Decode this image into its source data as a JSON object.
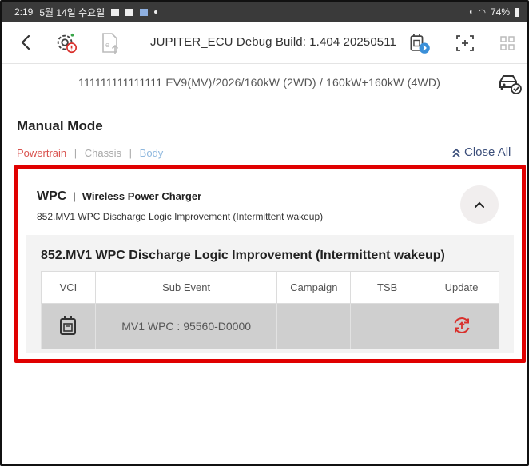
{
  "status_bar": {
    "time": "2:19",
    "date": "5월 14일 수요일",
    "battery": "74%"
  },
  "app_bar": {
    "title": "JUPITER_ECU Debug Build: 1.404 20250511",
    "icons": [
      "back-icon",
      "diagnostic-gear-icon",
      "export-file-icon",
      "vci-bluetooth-icon",
      "add-screen-icon",
      "grid-menu-icon"
    ]
  },
  "vehicle": {
    "info": "111111111111111 EV9(MV)/2026/160kW (2WD) / 160kW+160kW (4WD)",
    "icon": "vehicle-check-icon"
  },
  "manual_mode": {
    "title": "Manual Mode",
    "tabs": {
      "powertrain": "Powertrain",
      "chassis": "Chassis",
      "body": "Body",
      "separator": "|"
    },
    "close_all": "Close All"
  },
  "card": {
    "code": "WPC",
    "separator": "|",
    "name": "Wireless Power Charger",
    "description": "852.MV1 WPC Discharge Logic Improvement (Intermittent wakeup)",
    "body_title": "852.MV1 WPC Discharge Logic Improvement (Intermittent wakeup)",
    "table": {
      "headers": [
        "VCI",
        "Sub Event",
        "Campaign",
        "TSB",
        "Update"
      ],
      "rows": [
        {
          "vci_icon": "vci-device-icon",
          "sub_event": "MV1 WPC : 95560-D0000",
          "campaign": "",
          "tsb": "",
          "update_icon": "update-sync-icon"
        }
      ]
    }
  },
  "colors": {
    "highlight": "#e00000",
    "tab_powertrain": "#d9534f",
    "tab_body": "#8fb8de",
    "close_all": "#3b4e7a",
    "update_icon": "#d9302c"
  }
}
